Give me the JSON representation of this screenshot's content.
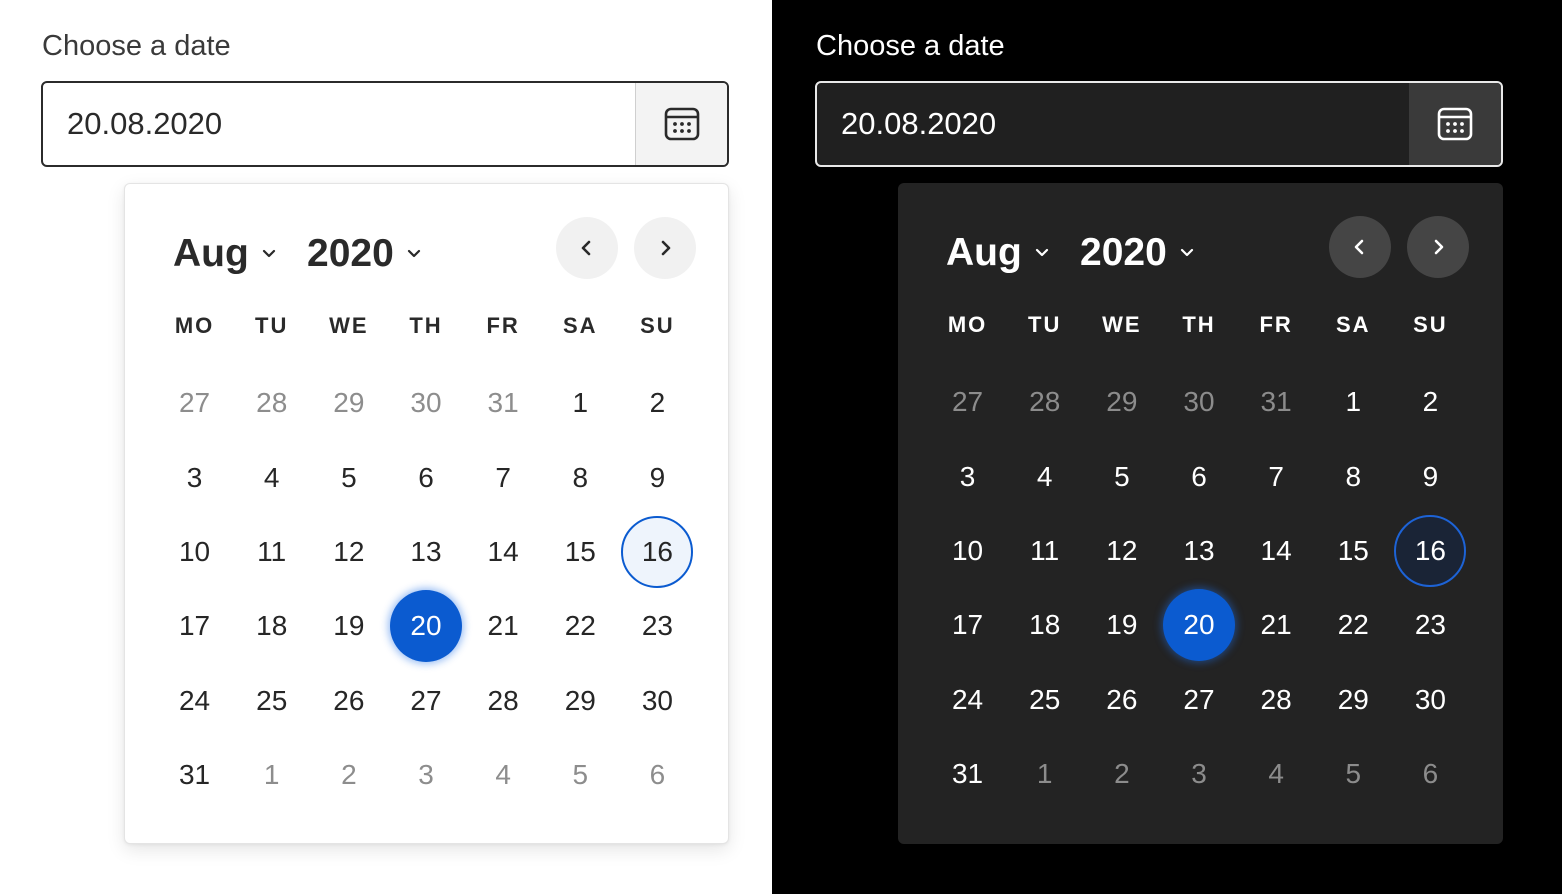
{
  "colors": {
    "accent": "#0b5bd0",
    "light_bg": "#ffffff",
    "dark_bg": "#000000",
    "dark_surface": "#232323"
  },
  "light": {
    "label": "Choose a date",
    "input_value": "20.08.2020",
    "calendar_icon": "calendar-icon",
    "month": "Aug",
    "year": "2020",
    "prev_icon": "chevron-left-icon",
    "next_icon": "chevron-right-icon",
    "weekdays": [
      "MO",
      "TU",
      "WE",
      "TH",
      "FR",
      "SA",
      "SU"
    ],
    "weeks": [
      [
        "27",
        "28",
        "29",
        "30",
        "31",
        "1",
        "2"
      ],
      [
        "3",
        "4",
        "5",
        "6",
        "7",
        "8",
        "9"
      ],
      [
        "10",
        "11",
        "12",
        "13",
        "14",
        "15",
        "16"
      ],
      [
        "17",
        "18",
        "19",
        "20",
        "21",
        "22",
        "23"
      ],
      [
        "24",
        "25",
        "26",
        "27",
        "28",
        "29",
        "30"
      ],
      [
        "31",
        "1",
        "2",
        "3",
        "4",
        "5",
        "6"
      ]
    ],
    "today": "16",
    "selected": "20"
  },
  "dark": {
    "label": "Choose a date",
    "input_value": "20.08.2020",
    "calendar_icon": "calendar-icon",
    "month": "Aug",
    "year": "2020",
    "prev_icon": "chevron-left-icon",
    "next_icon": "chevron-right-icon",
    "weekdays": [
      "MO",
      "TU",
      "WE",
      "TH",
      "FR",
      "SA",
      "SU"
    ],
    "weeks": [
      [
        "27",
        "28",
        "29",
        "30",
        "31",
        "1",
        "2"
      ],
      [
        "3",
        "4",
        "5",
        "6",
        "7",
        "8",
        "9"
      ],
      [
        "10",
        "11",
        "12",
        "13",
        "14",
        "15",
        "16"
      ],
      [
        "17",
        "18",
        "19",
        "20",
        "21",
        "22",
        "23"
      ],
      [
        "24",
        "25",
        "26",
        "27",
        "28",
        "29",
        "30"
      ],
      [
        "31",
        "1",
        "2",
        "3",
        "4",
        "5",
        "6"
      ]
    ],
    "today": "16",
    "selected": "20"
  }
}
